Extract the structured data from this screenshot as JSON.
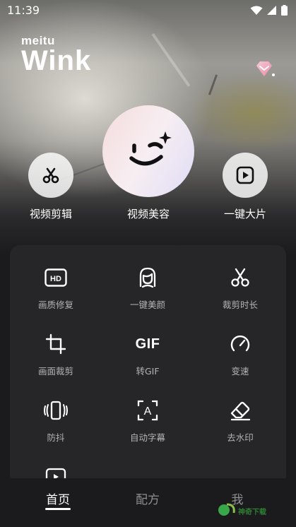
{
  "status_bar": {
    "time": "11:39"
  },
  "brand": {
    "small": "meitu",
    "big": "Wink"
  },
  "main_features": [
    {
      "label": "视频剪辑",
      "icon": "scissors-icon"
    },
    {
      "label": "视频美容",
      "icon": "wink-face-icon"
    },
    {
      "label": "一键大片",
      "icon": "play-icon"
    }
  ],
  "tools": [
    {
      "label": "画质修复",
      "icon": "hd-icon",
      "glyph": "HD"
    },
    {
      "label": "一键美颜",
      "icon": "face-icon"
    },
    {
      "label": "裁剪时长",
      "icon": "scissors-icon"
    },
    {
      "label": "画面裁剪",
      "icon": "crop-icon"
    },
    {
      "label": "转GIF",
      "icon": "gif-icon",
      "glyph": "GIF"
    },
    {
      "label": "变速",
      "icon": "speedometer-icon"
    },
    {
      "label": "防抖",
      "icon": "stabilize-icon"
    },
    {
      "label": "自动字幕",
      "icon": "subtitle-icon",
      "glyph": "A"
    },
    {
      "label": "去水印",
      "icon": "eraser-icon"
    }
  ],
  "tabs": [
    {
      "label": "首页",
      "active": true
    },
    {
      "label": "配方",
      "active": false
    },
    {
      "label": "我",
      "active": false
    }
  ],
  "watermark": {
    "text": "神奇下载"
  },
  "colors": {
    "panel": "#262628",
    "background": "#1b1b1d",
    "label_muted": "#b3b3b3",
    "tab_inactive": "#8e8e8e"
  }
}
